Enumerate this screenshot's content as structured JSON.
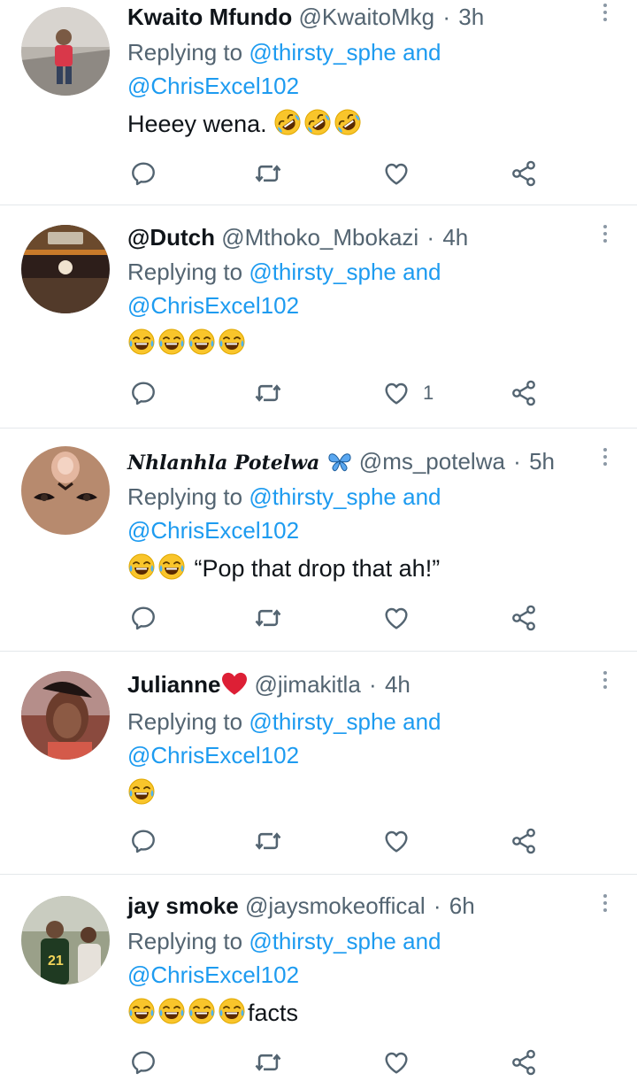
{
  "replying_prefix": "Replying to",
  "conjunction": "and",
  "tweets": [
    {
      "name": "Kwaito Mfundo",
      "handle": "@KwaitoMkg",
      "separator": "·",
      "time": "3h",
      "mentions": [
        "@thirsty_sphe",
        "@ChrisExcel102"
      ],
      "text": "Heeey wena.",
      "emojis": [
        "rolling-on-floor-laughing",
        "rolling-on-floor-laughing",
        "rolling-on-floor-laughing"
      ],
      "like_count": ""
    },
    {
      "name": "@Dutch",
      "handle": "@Mthoko_Mbokazi",
      "separator": "·",
      "time": "4h",
      "mentions": [
        "@thirsty_sphe",
        "@ChrisExcel102"
      ],
      "text": "",
      "emojis": [
        "tears-of-joy",
        "tears-of-joy",
        "tears-of-joy",
        "tears-of-joy"
      ],
      "like_count": "1"
    },
    {
      "name": "Nhlanhla Potelwa",
      "handle": "@ms_potelwa",
      "separator": "·",
      "time": "5h",
      "mentions": [
        "@thirsty_sphe",
        "@ChrisExcel102"
      ],
      "text": "“Pop that drop that ah!”",
      "emojis": [
        "tears-of-joy",
        "tears-of-joy"
      ],
      "like_count": ""
    },
    {
      "name": "Julianne",
      "handle": "@jimakitla",
      "separator": "·",
      "time": "4h",
      "mentions": [
        "@thirsty_sphe",
        "@ChrisExcel102"
      ],
      "text": "",
      "emojis": [
        "tears-of-joy"
      ],
      "like_count": ""
    },
    {
      "name": "jay smoke",
      "handle": "@jaysmokeoffical",
      "separator": "·",
      "time": "6h",
      "mentions": [
        "@thirsty_sphe",
        "@ChrisExcel102"
      ],
      "text": "facts",
      "emojis": [
        "tears-of-joy",
        "tears-of-joy",
        "tears-of-joy",
        "tears-of-joy"
      ],
      "like_count": ""
    }
  ],
  "colors": {
    "mention_blue": "#1d9bf0",
    "secondary_gray": "#536471",
    "divider": "#e4e8eb"
  }
}
